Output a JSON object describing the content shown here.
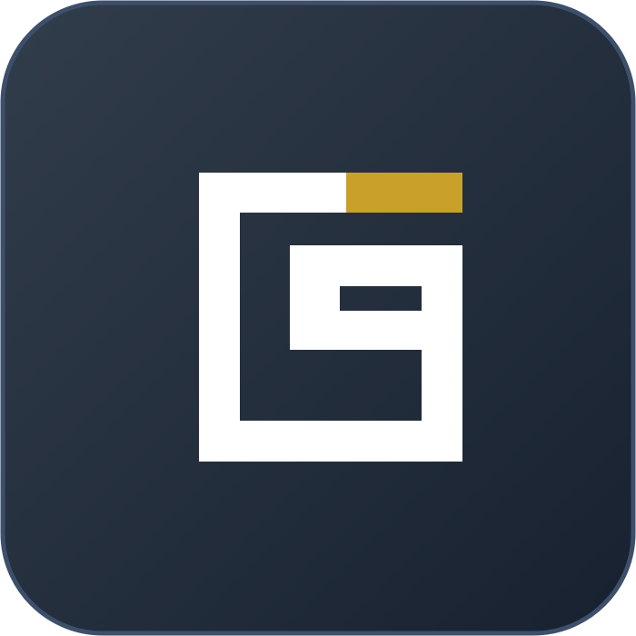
{
  "icon": {
    "name": "app-logo",
    "background_start": "#323d4c",
    "background_end": "#17212f",
    "border_color": "#3d4f6a",
    "glyph_color": "#ffffff",
    "accent_color": "#c9a02a"
  }
}
